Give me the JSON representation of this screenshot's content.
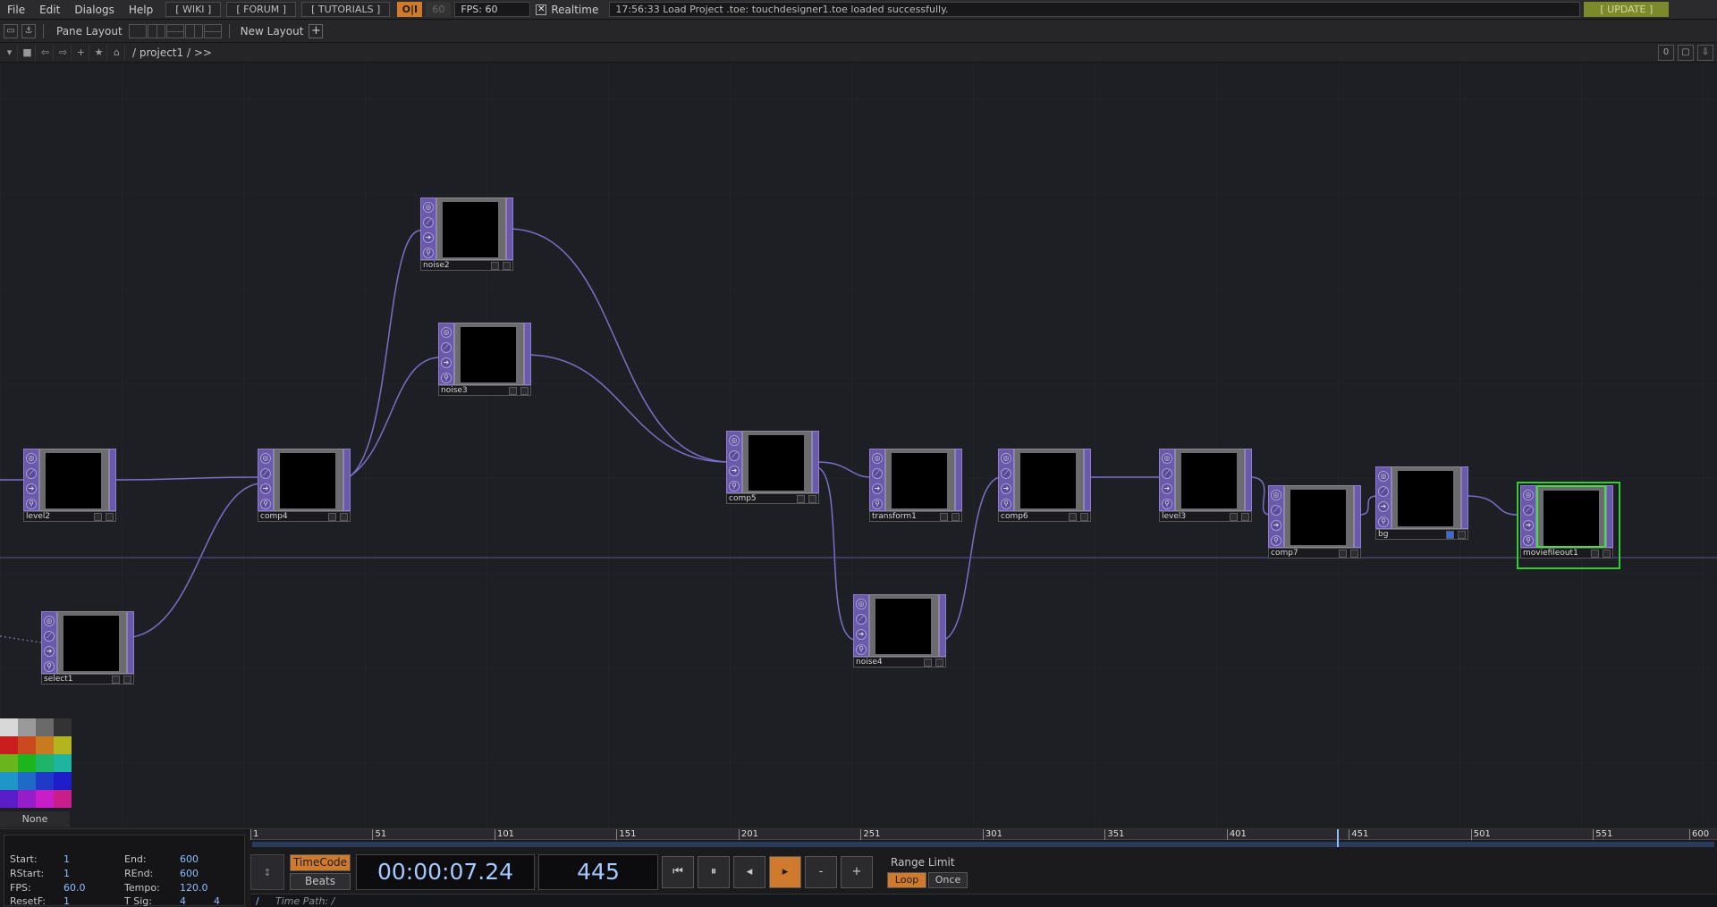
{
  "menubar": {
    "items": [
      "File",
      "Edit",
      "Dialogs",
      "Help"
    ],
    "links": [
      "[ WIKI ]",
      "[ FORUM ]",
      "[ TUTORIALS ]"
    ],
    "perf_toggle": "O|I",
    "fps_target": "60",
    "fps_display": "FPS:  60",
    "realtime_label": "Realtime",
    "realtime_checked": "✕",
    "status_message": "17:56:33 Load Project .toe: touchdesigner1.toe loaded successfully.",
    "update_label": "[ UPDATE ]"
  },
  "panebar": {
    "pane_layout_label": "Pane Layout",
    "new_layout_label": "New Layout",
    "plus": "+"
  },
  "pathbar": {
    "path": "/ project1 / >>",
    "right_label": "0"
  },
  "nodes": [
    {
      "name": "level2"
    },
    {
      "name": "comp4"
    },
    {
      "name": "noise2"
    },
    {
      "name": "noise3"
    },
    {
      "name": "comp5"
    },
    {
      "name": "transform1"
    },
    {
      "name": "comp6"
    },
    {
      "name": "level3"
    },
    {
      "name": "comp7"
    },
    {
      "name": "bg"
    },
    {
      "name": "moviefileout1"
    },
    {
      "name": "noise4"
    },
    {
      "name": "select1"
    }
  ],
  "palette": {
    "none_label": "None",
    "colors": [
      "#d8d8d8",
      "#9a9a9a",
      "#6a6a6a",
      "#333333",
      "#c81e1e",
      "#c84a1e",
      "#c87a1e",
      "#b4b41e",
      "#6ab41e",
      "#1eb41e",
      "#1eb46a",
      "#1eb4a0",
      "#1e96c8",
      "#1e6ac8",
      "#1e3ac8",
      "#1e1ec8",
      "#5a1ec8",
      "#961ec8",
      "#c81ec8",
      "#c81e8c"
    ]
  },
  "time_settings": {
    "start_label": "Start:",
    "start": "1",
    "end_label": "End:",
    "end": "600",
    "rstart_label": "RStart:",
    "rstart": "1",
    "rend_label": "REnd:",
    "rend": "600",
    "fps_label": "FPS:",
    "fps": "60.0",
    "tempo_label": "Tempo:",
    "tempo": "120.0",
    "resetf_label": "ResetF:",
    "resetf": "1",
    "tsig_label": "T Sig:",
    "tsig_a": "4",
    "tsig_b": "4"
  },
  "timeline": {
    "ticks": [
      "1",
      "51",
      "101",
      "151",
      "201",
      "251",
      "301",
      "351",
      "401",
      "451",
      "501",
      "551",
      "600"
    ],
    "timecode_label": "TimeCode",
    "beats_label": "Beats",
    "timecode": "00:00:07.24",
    "frame": "445",
    "minus": "-",
    "plus": "+",
    "range_limit_label": "Range Limit",
    "loop_label": "Loop",
    "once_label": "Once",
    "time_path_slash": "/",
    "time_path": "Time Path: /"
  }
}
